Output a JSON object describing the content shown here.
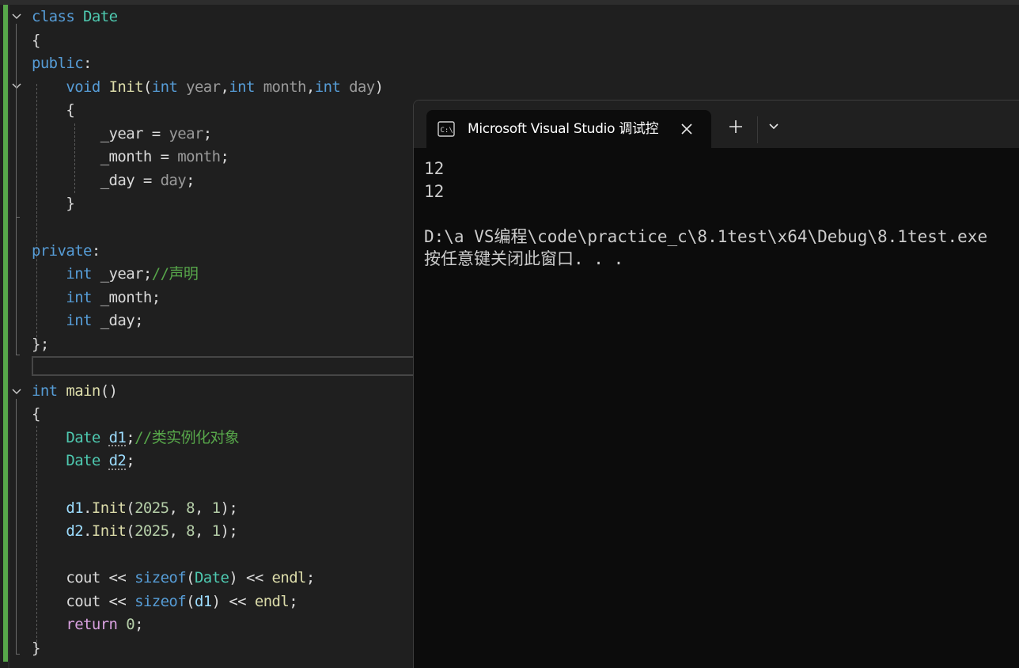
{
  "editor": {
    "lines": [
      {
        "tokens": [
          {
            "t": "class ",
            "c": "kw"
          },
          {
            "t": "Date",
            "c": "ty"
          }
        ]
      },
      {
        "tokens": [
          {
            "t": "{",
            "c": "pl"
          }
        ]
      },
      {
        "tokens": [
          {
            "t": "public",
            "c": "kw"
          },
          {
            "t": ":",
            "c": "pl"
          }
        ]
      },
      {
        "tokens": [
          {
            "t": "    ",
            "c": "pl"
          },
          {
            "t": "void ",
            "c": "kw"
          },
          {
            "t": "Init",
            "c": "fn"
          },
          {
            "t": "(",
            "c": "pl"
          },
          {
            "t": "int ",
            "c": "kw"
          },
          {
            "t": "year",
            "c": "pa"
          },
          {
            "t": ",",
            "c": "pl"
          },
          {
            "t": "int ",
            "c": "kw"
          },
          {
            "t": "month",
            "c": "pa"
          },
          {
            "t": ",",
            "c": "pl"
          },
          {
            "t": "int ",
            "c": "kw"
          },
          {
            "t": "day",
            "c": "pa"
          },
          {
            "t": ")",
            "c": "pl"
          }
        ]
      },
      {
        "tokens": [
          {
            "t": "    {",
            "c": "pl"
          }
        ]
      },
      {
        "tokens": [
          {
            "t": "        _year = ",
            "c": "pl"
          },
          {
            "t": "year",
            "c": "pa"
          },
          {
            "t": ";",
            "c": "pl"
          }
        ]
      },
      {
        "tokens": [
          {
            "t": "        _month = ",
            "c": "pl"
          },
          {
            "t": "month",
            "c": "pa"
          },
          {
            "t": ";",
            "c": "pl"
          }
        ]
      },
      {
        "tokens": [
          {
            "t": "        _day = ",
            "c": "pl"
          },
          {
            "t": "day",
            "c": "pa"
          },
          {
            "t": ";",
            "c": "pl"
          }
        ]
      },
      {
        "tokens": [
          {
            "t": "    }",
            "c": "pl"
          }
        ]
      },
      {
        "tokens": []
      },
      {
        "tokens": [
          {
            "t": "private",
            "c": "kw"
          },
          {
            "t": ":",
            "c": "pl"
          }
        ]
      },
      {
        "tokens": [
          {
            "t": "    ",
            "c": "pl"
          },
          {
            "t": "int ",
            "c": "kw"
          },
          {
            "t": "_year;",
            "c": "pl"
          },
          {
            "t": "//声明",
            "c": "cm"
          }
        ]
      },
      {
        "tokens": [
          {
            "t": "    ",
            "c": "pl"
          },
          {
            "t": "int ",
            "c": "kw"
          },
          {
            "t": "_month;",
            "c": "pl"
          }
        ]
      },
      {
        "tokens": [
          {
            "t": "    ",
            "c": "pl"
          },
          {
            "t": "int ",
            "c": "kw"
          },
          {
            "t": "_day;",
            "c": "pl"
          }
        ]
      },
      {
        "tokens": [
          {
            "t": "};",
            "c": "pl"
          }
        ]
      },
      {
        "tokens": []
      },
      {
        "tokens": [
          {
            "t": "int ",
            "c": "kw"
          },
          {
            "t": "main",
            "c": "fn"
          },
          {
            "t": "()",
            "c": "pl"
          }
        ]
      },
      {
        "tokens": [
          {
            "t": "{",
            "c": "pl"
          }
        ]
      },
      {
        "tokens": [
          {
            "t": "    ",
            "c": "pl"
          },
          {
            "t": "Date ",
            "c": "ty"
          },
          {
            "t": "d1",
            "c": "sq"
          },
          {
            "t": ";",
            "c": "pl"
          },
          {
            "t": "//类实例化对象",
            "c": "cm"
          }
        ]
      },
      {
        "tokens": [
          {
            "t": "    ",
            "c": "pl"
          },
          {
            "t": "Date ",
            "c": "ty"
          },
          {
            "t": "d2",
            "c": "sq"
          },
          {
            "t": ";",
            "c": "pl"
          }
        ]
      },
      {
        "tokens": []
      },
      {
        "tokens": [
          {
            "t": "    ",
            "c": "pl"
          },
          {
            "t": "d1",
            "c": "va"
          },
          {
            "t": ".",
            "c": "pl"
          },
          {
            "t": "Init",
            "c": "fn"
          },
          {
            "t": "(",
            "c": "pl"
          },
          {
            "t": "2025",
            "c": "nu"
          },
          {
            "t": ", ",
            "c": "pl"
          },
          {
            "t": "8",
            "c": "nu"
          },
          {
            "t": ", ",
            "c": "pl"
          },
          {
            "t": "1",
            "c": "nu"
          },
          {
            "t": ");",
            "c": "pl"
          }
        ]
      },
      {
        "tokens": [
          {
            "t": "    ",
            "c": "pl"
          },
          {
            "t": "d2",
            "c": "va"
          },
          {
            "t": ".",
            "c": "pl"
          },
          {
            "t": "Init",
            "c": "fn"
          },
          {
            "t": "(",
            "c": "pl"
          },
          {
            "t": "2025",
            "c": "nu"
          },
          {
            "t": ", ",
            "c": "pl"
          },
          {
            "t": "8",
            "c": "nu"
          },
          {
            "t": ", ",
            "c": "pl"
          },
          {
            "t": "1",
            "c": "nu"
          },
          {
            "t": ");",
            "c": "pl"
          }
        ]
      },
      {
        "tokens": []
      },
      {
        "tokens": [
          {
            "t": "    ",
            "c": "pl"
          },
          {
            "t": "cout",
            "c": "pl"
          },
          {
            "t": " << ",
            "c": "pl"
          },
          {
            "t": "sizeof",
            "c": "kw"
          },
          {
            "t": "(",
            "c": "pl"
          },
          {
            "t": "Date",
            "c": "ty"
          },
          {
            "t": ") << ",
            "c": "pl"
          },
          {
            "t": "endl",
            "c": "fn"
          },
          {
            "t": ";",
            "c": "pl"
          }
        ]
      },
      {
        "tokens": [
          {
            "t": "    ",
            "c": "pl"
          },
          {
            "t": "cout",
            "c": "pl"
          },
          {
            "t": " << ",
            "c": "pl"
          },
          {
            "t": "sizeof",
            "c": "kw"
          },
          {
            "t": "(",
            "c": "pl"
          },
          {
            "t": "d1",
            "c": "va"
          },
          {
            "t": ") << ",
            "c": "pl"
          },
          {
            "t": "endl",
            "c": "fn"
          },
          {
            "t": ";",
            "c": "pl"
          }
        ]
      },
      {
        "tokens": [
          {
            "t": "    ",
            "c": "pl"
          },
          {
            "t": "return ",
            "c": "ct"
          },
          {
            "t": "0",
            "c": "nu"
          },
          {
            "t": ";",
            "c": "pl"
          }
        ]
      },
      {
        "tokens": [
          {
            "t": "}",
            "c": "pl"
          }
        ]
      }
    ]
  },
  "terminal": {
    "tab_title": "Microsoft Visual Studio 调试控",
    "tab_icon": "terminal-icon",
    "close_icon": "close-icon",
    "new_tab_label": "+",
    "dropdown_icon": "chevron-down-icon",
    "output": [
      "12",
      "12",
      "",
      "D:\\a VS编程\\code\\practice_c\\8.1test\\x64\\Debug\\8.1test.exe",
      "按任意键关闭此窗口. . ."
    ]
  },
  "colors": {
    "keyword": "#569cd6",
    "type": "#4ec9b0",
    "function": "#dcdcaa",
    "comment": "#57a64a",
    "number": "#b5cea8",
    "control": "#d8a0df",
    "change_bar": "#57a64a"
  }
}
